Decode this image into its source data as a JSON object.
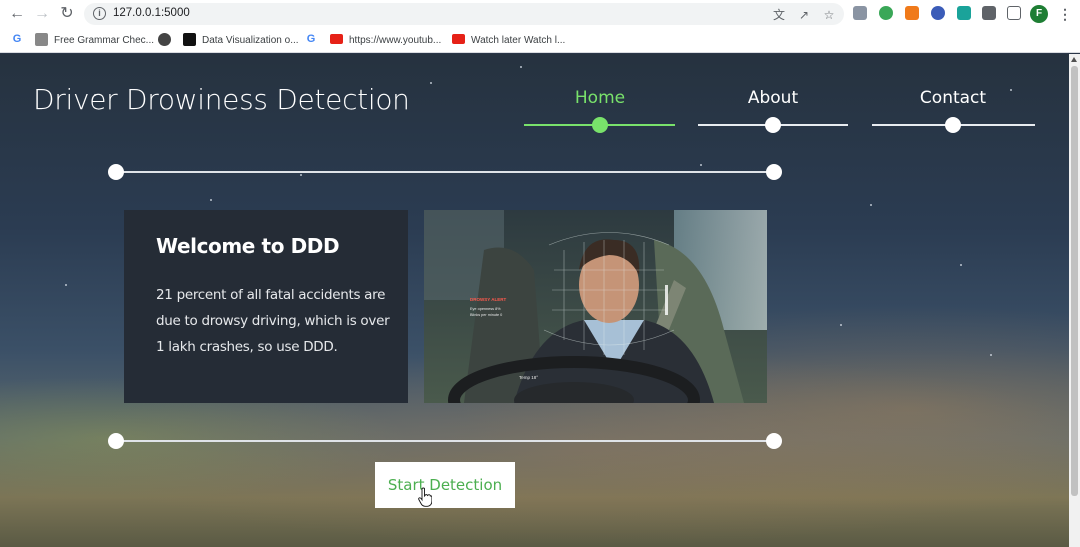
{
  "browser": {
    "url": "127.0.0.1:5000",
    "profile_initial": "F",
    "bookmarks": [
      {
        "label": "Free Grammar Chec...",
        "icon": "grammar-icon"
      },
      {
        "label": "Data Visualization o...",
        "icon": "data-viz-icon"
      },
      {
        "label": "https://www.youtub...",
        "icon": "youtube-icon"
      },
      {
        "label": "Watch later Watch l...",
        "icon": "youtube-icon"
      }
    ]
  },
  "site": {
    "title": "Driver Drowiness Detection",
    "nav": [
      {
        "label": "Home",
        "active": true
      },
      {
        "label": "About",
        "active": false
      },
      {
        "label": "Contact",
        "active": false
      }
    ],
    "accent_color": "#79e26b"
  },
  "welcome": {
    "title": "Welcome to DDD",
    "text": "21 percent of all fatal accidents are due to drowsy driving, which is over 1 lakh crashes, so use DDD."
  },
  "hero_image": {
    "alt": "driver monitoring image",
    "overlay_label": "DROWSY ALERT",
    "overlay_lines": [
      "Eye openness 8%",
      "Blinks per minute 0"
    ],
    "temp": "Temp 18°"
  },
  "cta": {
    "label": "Start Detection",
    "color": "#4caf50"
  }
}
